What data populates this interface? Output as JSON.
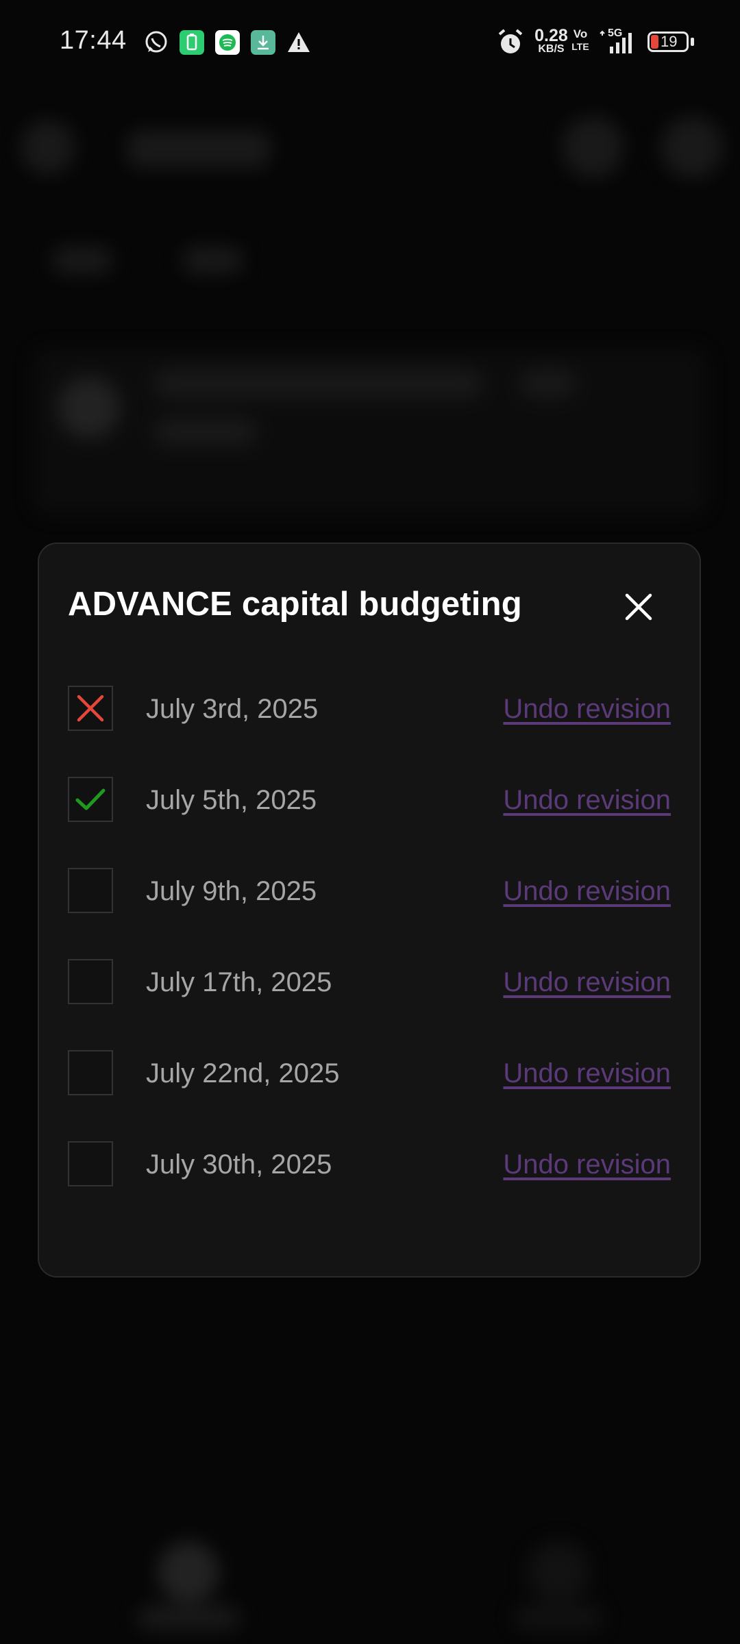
{
  "status_bar": {
    "time": "17:44",
    "net_speed_value": "0.28",
    "net_speed_unit": "KB/S",
    "volte_top": "Vo",
    "volte_bottom": "LTE",
    "network_type": "5G",
    "battery_level": "19",
    "notification_icons": [
      "whatsapp-icon",
      "battery-saver-icon",
      "spotify-icon",
      "download-icon",
      "warning-icon"
    ]
  },
  "dialog": {
    "title": "ADVANCE capital budgeting",
    "close_icon": "close-icon",
    "rows": [
      {
        "date": "July 3rd, 2025",
        "status": "failed",
        "undo_label": "Undo revision"
      },
      {
        "date": "July 5th, 2025",
        "status": "done",
        "undo_label": "Undo revision"
      },
      {
        "date": "July 9th, 2025",
        "status": "pending",
        "undo_label": "Undo revision"
      },
      {
        "date": "July 17th, 2025",
        "status": "pending",
        "undo_label": "Undo revision"
      },
      {
        "date": "July 22nd, 2025",
        "status": "pending",
        "undo_label": "Undo revision"
      },
      {
        "date": "July 30th, 2025",
        "status": "pending",
        "undo_label": "Undo revision"
      }
    ]
  },
  "colors": {
    "failed_mark": "#e5483a",
    "done_mark": "#1f9a1f",
    "undo_link": "#5c3a7a",
    "dialog_bg": "#141414"
  }
}
